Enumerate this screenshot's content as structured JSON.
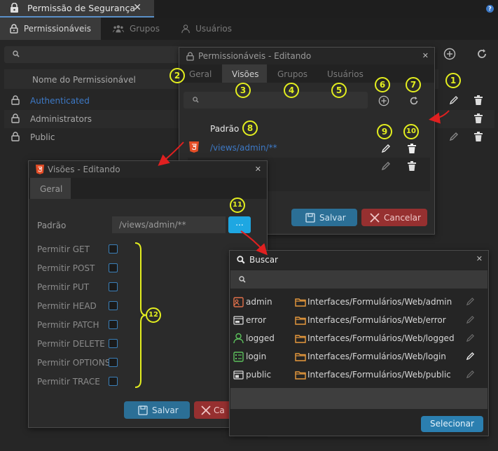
{
  "doc_tab": {
    "title": "Permissão de Segurança",
    "close": "✕"
  },
  "help": "?",
  "tabs": [
    {
      "label": "Permissionáveis",
      "active": true
    },
    {
      "label": "Grupos",
      "active": false
    },
    {
      "label": "Usuários",
      "active": false
    }
  ],
  "main": {
    "column_header": "Nome do Permissionável",
    "rows": [
      {
        "label": "Authenticated",
        "color": "#3d79c6"
      },
      {
        "label": "Administrators",
        "color": "#a8a8a8"
      },
      {
        "label": "Public",
        "color": "#a8a8a8"
      }
    ]
  },
  "edit_dialog": {
    "title": "Permissionáveis - Editando",
    "close": "✕",
    "tabs": [
      "Geral",
      "Visões",
      "Grupos",
      "Usuários"
    ],
    "active_tab": "Visões",
    "rows": [
      {
        "label": "Padrão"
      },
      {
        "label": "/views/admin/**"
      }
    ],
    "save": "Salvar",
    "cancel": "Cancelar"
  },
  "view_dialog": {
    "title": "Visões - Editando",
    "close": "✕",
    "tab": "Geral",
    "padrao_label": "Padrão",
    "padrao_value": "/views/admin/**",
    "browse": "...",
    "permissions": [
      "Permitir GET",
      "Permitir POST",
      "Permitir PUT",
      "Permitir HEAD",
      "Permitir PATCH",
      "Permitir DELETE",
      "Permitir OPTIONS",
      "Permitir TRACE"
    ],
    "save": "Salvar",
    "cancel": "Ca"
  },
  "buscar_dialog": {
    "title": "Buscar",
    "close": "✕",
    "items": [
      {
        "name": "admin",
        "path": "Interfaces/Formulários/Web/admin",
        "icon": "admin-icon",
        "icon_color": "#e0704a"
      },
      {
        "name": "error",
        "path": "Interfaces/Formulários/Web/error",
        "icon": "window-error-icon",
        "icon_color": "#d8d8d8"
      },
      {
        "name": "logged",
        "path": "Interfaces/Formulários/Web/logged",
        "icon": "user-icon",
        "icon_color": "#5cc05c"
      },
      {
        "name": "login",
        "path": "Interfaces/Formulários/Web/login",
        "icon": "form-list-icon",
        "icon_color": "#5cc05c"
      },
      {
        "name": "public",
        "path": "Interfaces/Formulários/Web/public",
        "icon": "window-lock-icon",
        "icon_color": "#d8d8d8"
      }
    ],
    "select": "Selecionar"
  },
  "callouts": [
    "1",
    "2",
    "3",
    "4",
    "5",
    "6",
    "7",
    "8",
    "9",
    "10",
    "11",
    "12"
  ],
  "colors": {
    "accent": "#2b6f96",
    "danger": "#963030",
    "callout": "#e3ee1f",
    "link": "#3d79c6",
    "folder": "#e89a3c",
    "html5": "#e44d26"
  }
}
